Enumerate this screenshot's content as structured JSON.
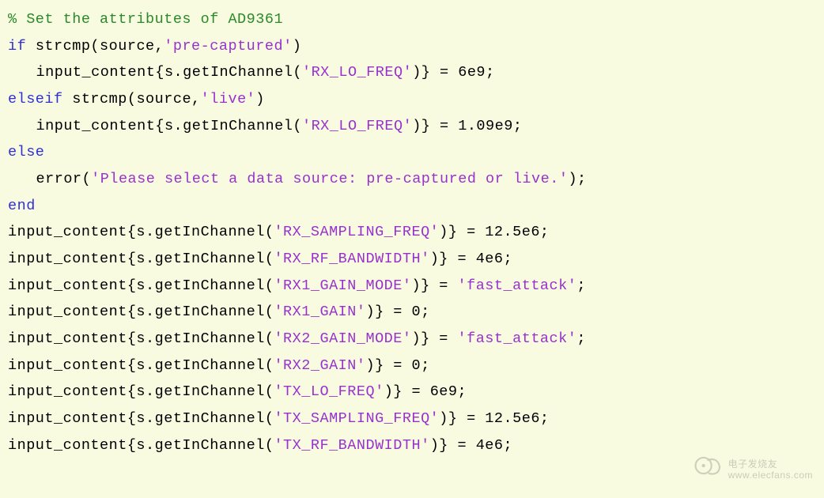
{
  "code": {
    "comment": "% Set the attributes of AD9361",
    "kw_if": "if",
    "kw_elseif": "elseif",
    "kw_else": "else",
    "kw_end": "end",
    "strcmp1_pre": " strcmp(source,",
    "strcmp1_str": "'pre-captured'",
    "strcmp1_post": ")",
    "strcmp2_pre": " strcmp(source,",
    "strcmp2_str": "'live'",
    "strcmp2_post": ")",
    "rx_lo_6e9_pre": "input_content{s.getInChannel(",
    "rx_lo_str": "'RX_LO_FREQ'",
    "rx_lo_6e9_post": ")} = 6e9;",
    "rx_lo_109_post": ")} = 1.09e9;",
    "error_pre": "error(",
    "error_str": "'Please select a data source: pre-captured or live.'",
    "error_post": ");",
    "rx_sf_str": "'RX_SAMPLING_FREQ'",
    "rx_sf_post": ")} = 12.5e6;",
    "rx_bw_str": "'RX_RF_BANDWIDTH'",
    "rx_bw_post": ")} = 4e6;",
    "rx1_gm_str": "'RX1_GAIN_MODE'",
    "gm_post_pre": ")} = ",
    "gm_val_str": "'fast_attack'",
    "gm_post_post": ";",
    "rx1_g_str": "'RX1_GAIN'",
    "gain_post": ")} = 0;",
    "rx2_gm_str": "'RX2_GAIN_MODE'",
    "rx2_g_str": "'RX2_GAIN'",
    "tx_lo_str": "'TX_LO_FREQ'",
    "tx_lo_post": ")} = 6e9;",
    "tx_sf_str": "'TX_SAMPLING_FREQ'",
    "tx_sf_post": ")} = 12.5e6;",
    "tx_bw_str": "'TX_RF_BANDWIDTH'",
    "tx_bw_post": ")} = 4e6;",
    "ic_pre": "input_content{s.getInChannel("
  },
  "watermark": {
    "brand": "电子发烧友",
    "url": "www.elecfans.com"
  }
}
